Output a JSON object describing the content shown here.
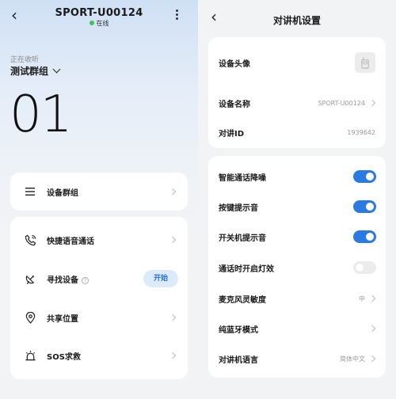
{
  "left": {
    "device_name": "SPORT-U00124",
    "status": "在线",
    "status_color": "#3ec25c",
    "receiving_label": "正在收听",
    "group_name": "测试群组",
    "channel_number": "01",
    "card1": {
      "items": [
        {
          "label": "设备群组",
          "icon": "list-icon"
        }
      ]
    },
    "card2": {
      "items": [
        {
          "label": "快捷语音通话",
          "icon": "phone-icon"
        },
        {
          "label": "寻找设备",
          "icon": "satellite-dish-icon",
          "action": "开始"
        },
        {
          "label": "共享位置",
          "icon": "location-pin-icon"
        },
        {
          "label": "SOS求救",
          "icon": "alarm-light-icon"
        }
      ]
    }
  },
  "right": {
    "title": "对讲机设置",
    "info_card": [
      {
        "label": "设备头像"
      },
      {
        "label": "设备名称",
        "value": "SPORT-U00124"
      },
      {
        "label": "对讲ID",
        "value": "1939642"
      }
    ],
    "settings_card": [
      {
        "label": "智能通话降噪",
        "toggle": "on"
      },
      {
        "label": "按键提示音",
        "toggle": "on"
      },
      {
        "label": "开关机提示音",
        "toggle": "on"
      },
      {
        "label": "通话时开启灯效",
        "toggle": "off"
      },
      {
        "label": "麦克风灵敏度",
        "value": "中"
      },
      {
        "label": "纯蓝牙模式"
      },
      {
        "label": "对讲机语言",
        "value": "简体中文"
      }
    ],
    "accent_color": "#2b7ae4"
  }
}
